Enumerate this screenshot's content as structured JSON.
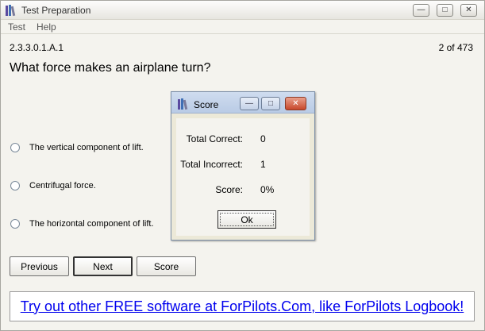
{
  "window": {
    "title": "Test Preparation",
    "minimize_glyph": "—",
    "maximize_glyph": "□",
    "close_glyph": "✕"
  },
  "menu": {
    "items": [
      "Test",
      "Help"
    ]
  },
  "question": {
    "id": "2.3.3.0.1.A.1",
    "counter": "2 of 473",
    "text": "What force makes an airplane turn?",
    "answers": [
      "The vertical component of lift.",
      "Centrifugal force.",
      "The horizontal component of lift."
    ]
  },
  "buttons": {
    "previous": "Previous",
    "next": "Next",
    "score": "Score"
  },
  "ad": {
    "text": "Try out other FREE software at ForPilots.Com, like ForPilots Logbook!"
  },
  "score_dialog": {
    "title": "Score",
    "rows": [
      {
        "label": "Total Correct:",
        "value": "0"
      },
      {
        "label": "Total Incorrect:",
        "value": "1"
      },
      {
        "label": "Score:",
        "value": "0%"
      }
    ],
    "ok_label": "Ok"
  },
  "colors": {
    "accent_link": "#0000ee",
    "dialog_close": "#c7472b"
  }
}
